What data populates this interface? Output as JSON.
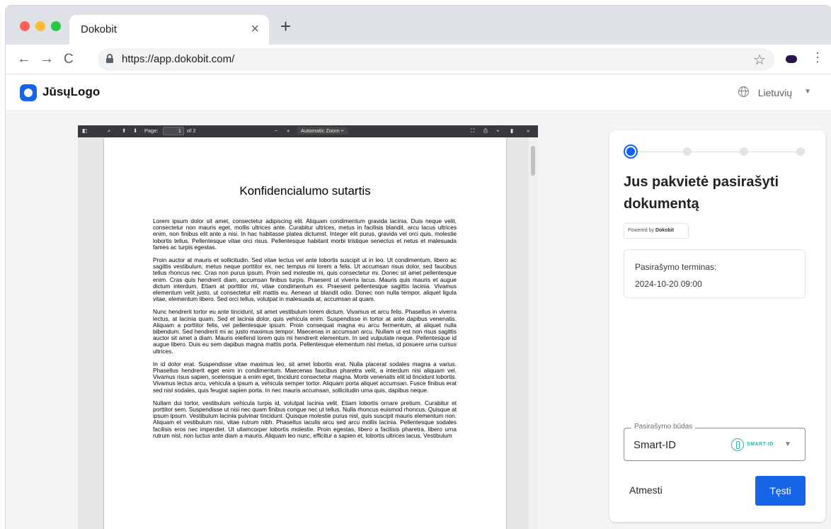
{
  "browser": {
    "tab_title": "Dokobit",
    "tab_close": "×",
    "new_tab": "+",
    "url": "https://app.dokobit.com/",
    "back": "←",
    "forward": "→",
    "reload": "C",
    "star": "☆",
    "menu": "⋮"
  },
  "header": {
    "logo_text": "JūsųLogo",
    "language": "Lietuvių",
    "caret": "▼"
  },
  "pdf_viewer": {
    "page_label": "Page:",
    "page_number": "1",
    "page_total": "of 2",
    "zoom_minus": "−",
    "zoom_plus": "+",
    "zoom_level": "Automatic Zoom ÷",
    "more": "»",
    "document": {
      "title": "Konfidencialumo sutartis",
      "paragraphs": [
        "Lorem ipsum dolor sit amet, consectetur adipiscing elit. Aliquam condimentum gravida lacinia. Duis neque velit, consectetur non mauris eget, mollis ultrices ante. Curabitur ultrices, metus in facilisis blandit, arcu lacus ultrices enim, non finibus elit ante a nisi. In hac habitasse platea dictumst. Integer elit purus, gravida vel orci quis, molestie lobortis tellus. Pellentesque vitae orci risus. Pellentesque habitant morbi tristique senectus et netus et malesuada fames ac turpis egestas.",
        "Proin auctor at mauris et sollicitudin. Sed vitae lectus vel ante lobortis suscipit ut in leo. Ut condimentum, libero ac sagittis vestibulum, metus neque porttitor ex, nec tempus mi lorem a felis. Ut accumsan risus dolor, sed faucibus tellus rhoncus nec. Cras non purus ipsum. Proin sed molestie mi, quis consectetur mi. Donec sit amet pellentesque enim. Cras quis hendrerit diam, accumsan finibus turpis. Praesent ut viverra lacus. Mauris quis mauris et augue dictum interdum. Etiam at porttitor mi, vitae condimentum ex. Praesent pellentesque sagittis lacinia. Vivamus elementum velit justo, ut consectetur elit mattis eu. Aenean ut blandit odio. Donec non nulla tempor, aliquet ligula vitae, elementum libero. Sed orci tellus, volutpat in malesuada at, accumsan at quam.",
        "Nunc hendrerit tortor eu ante tincidunt, sit amet vestibulum lorem dictum. Vivamus et arcu felis. Phasellus in viverra lectus, at lacinia quam. Sed et lacinia dolor, quis vehicula enim. Suspendisse in tortor at ante dapibus venenatis. Aliquam a porttitor felis, vel pellentesque ipsum. Proin consequat magna eu arcu fermentum, at aliquet nulla bibendum. Sed hendrerit mi ac justo maximus tempor. Maecenas in accumsan arcu. Nullam ut est non risus sagittis auctor sit amet a diam. Mauris eleifend lorem quis mi hendrerit elementum. In sed vulputate neque. Pellentesque id augue libero. Duis eu sem dapibus magna mattis porta. Pellentesque elementum nisl metus, id posuere urna cursus ultrices.",
        "In id dolor erat. Suspendisse vitae maximus leo, sit amet lobortis erat. Nulla placerat sodales magna a varius. Phasellus hendrerit eget enim in condimentum. Maecenas faucibus pharetra velit, a interdum nisi aliquam vel. Vivamus risus sapien, scelerisque a enim eget, tincidunt consectetur magna. Morbi venenatis elit id tincidunt lobortis. Vivamus lectus arcu, vehicula a ipsum a, vehicula semper tortor. Aliquam porta aliquet accumsan. Fusce finibus erat sed nisl sodales, quis feugiat sapien porta. In nec mauris accumsan, sollicitudin urna quis, dapibus neque.",
        "Nullam dui tortor, vestibulum vehicula turpis id, volutpat lacinia velit. Etiam lobortis ornare pretium. Curabitur et porttitor sem. Suspendisse ut nisi nec quam finibus congue nec ut tellus. Nulla rhoncus euismod rhoncus. Quisque at ipsum ipsum. Vestibulum lacinia pulvinar tincidunt. Quisque molestie purus nisl, quis suscipit mauris elementum non. Aliquam et vestibulum nisi, vitae rutrum nibh. Phasellus iaculis arcu sed arcu mollis lacinia. Pellentesque sodales facilisis eros nec imperdiet. Ut ullamcorper lobortis molestie. Proin egestas, libero a facilisis pharetra, libero urna rutrum nisl, non luctus ante diam a mauris. Aliquam leo nunc, efficitur a sapien et, lobortis ultrices lacus. Vestibulum"
      ]
    }
  },
  "panel": {
    "title": "Jus pakvietė pasirašyti dokumentą",
    "powered_by": "Powered by",
    "powered_brand": "Dokobit",
    "deadline_label": "Pasirašymo terminas:",
    "deadline_value": "2024-10-20 09:00",
    "method_legend": "Pasirašymo būdas",
    "method_value": "Smart-ID",
    "method_logo_text": "SMART-ID",
    "method_caret": "▼",
    "reject_label": "Atmesti",
    "continue_label": "Tęsti",
    "accent_color": "#1565e6"
  }
}
